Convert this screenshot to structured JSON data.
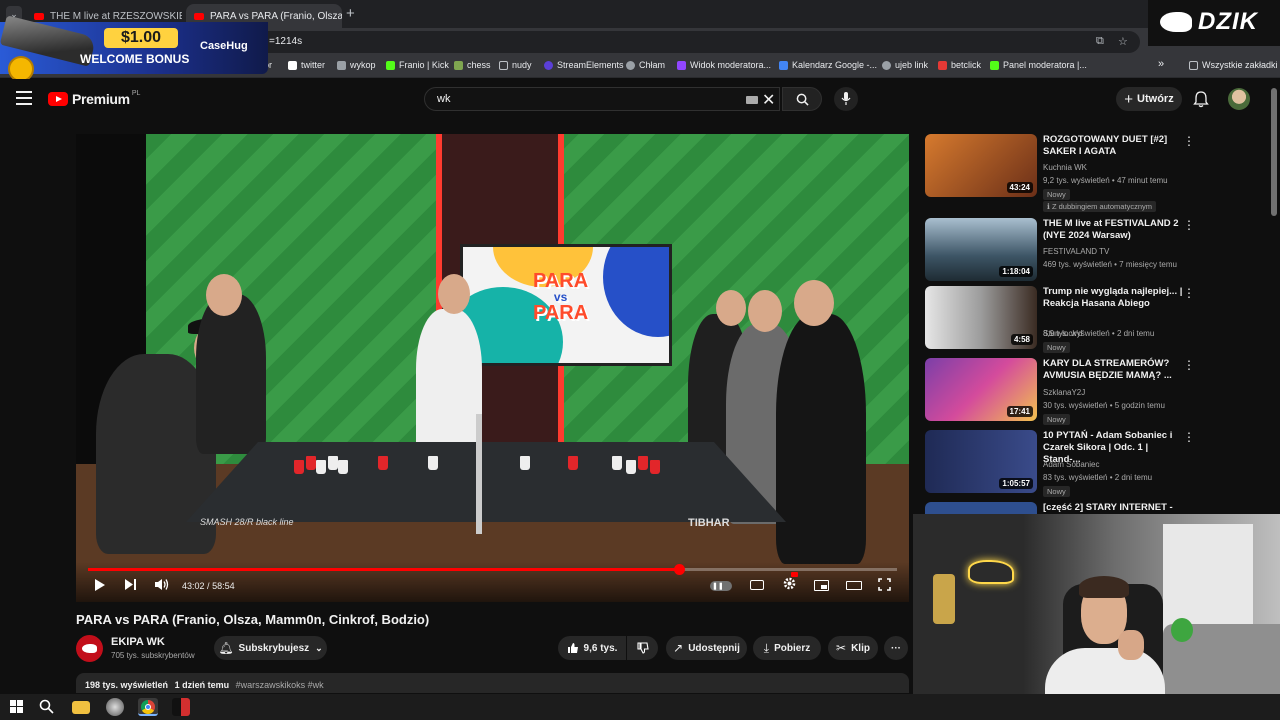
{
  "browser": {
    "tabs": [
      {
        "title": "THE M live at RZESZOWSKIE JUV",
        "active": false
      },
      {
        "title": "PARA vs PARA (Franio, Olsza, M",
        "active": true
      }
    ],
    "new_tab": "+",
    "close": "✕",
    "url_fragment": "=1214s",
    "bookmarks": [
      {
        "label": "twitter",
        "color": "#ffffff"
      },
      {
        "label": "wykop",
        "color": "#9aa0a6"
      },
      {
        "label": "Franio | Kick",
        "color": "#53fc18"
      },
      {
        "label": "chess",
        "color": "#7fa650"
      },
      {
        "label": "nudy",
        "color": "#9aa0a6"
      },
      {
        "label": "StreamElements",
        "color": "#5a3fd7"
      },
      {
        "label": "Chłam",
        "color": "#9aa0a6"
      },
      {
        "label": "Widok moderatora...",
        "color": "#9146ff"
      },
      {
        "label": "Kalendarz Google -...",
        "color": "#4285f4"
      },
      {
        "label": "ujeb link",
        "color": "#9aa0a6"
      },
      {
        "label": "betclick",
        "color": "#e53935"
      },
      {
        "label": "Panel moderatora |...",
        "color": "#53fc18"
      }
    ],
    "bookmarks_more": "»",
    "all_bookmarks": "Wszystkie zakładki",
    "partial_bookmark": "ior"
  },
  "overlay_ad": {
    "amount": "$1.00",
    "bonus": "WELCOME BONUS",
    "brand": "CaseHug"
  },
  "overlay_logo": "DZIK",
  "youtube": {
    "logo": "Premium",
    "country": "PL",
    "search_value": "wk",
    "create_label": "Utwórz",
    "video": {
      "title": "PARA vs PARA (Franio, Olsza, Mamm0n, Cinkrof, Bodzio)",
      "time_current": "43:02",
      "time_total": "58:54",
      "progress": 0.7307,
      "tv_text_1": "PARA",
      "tv_text_2": "vs",
      "tv_text_3": "PARA",
      "table_brand_left": "SMASH 28/R black line",
      "table_brand_right": "TIBHAR"
    },
    "channel": {
      "name": "EKIPA WK",
      "subscribers": "705 tys. subskrybentów",
      "subscribe_label": "Subskrybujesz"
    },
    "actions": {
      "likes": "9,6 tys.",
      "share": "Udostępnij",
      "download": "Pobierz",
      "clip": "Klip"
    },
    "description": {
      "views": "198 tys. wyświetleń",
      "date": "1 dzień temu",
      "tags": "#warszawskikoks #wk"
    },
    "recommendations": [
      {
        "title": "ROZGOTOWANY DUET [#2] SAKER I AGATA",
        "channel": "Kuchnia WK",
        "meta": "9,2 tys. wyświetleń • 47 minut temu",
        "duration": "43:24",
        "badges": [
          "Nowy",
          "Z dubbingiem automatycznym"
        ],
        "thumb": "#d67a2e"
      },
      {
        "title": "THE M live at FESTIVALAND 2 (NYE 2024 Warsaw)",
        "channel": "FESTIVALAND TV",
        "meta": "469 tys. wyświetleń • 7 miesięcy temu",
        "duration": "1:18:04",
        "badges": [],
        "thumb": "#5f7f95"
      },
      {
        "title": "Trump nie wygląda najlepiej... | Reakcja Hasana Abiego",
        "channel": "Stun-lock'd",
        "meta": "8,9 tys. wyświetleń • 2 dni temu",
        "duration": "4:58",
        "badges": [
          "Nowy"
        ],
        "thumb": "#c9c9c9"
      },
      {
        "title": "KARY DLA STREAMERÓW? AVMUSIA BĘDZIE MAMĄ? ...",
        "channel": "SzklanaY2J",
        "meta": "30 tys. wyświetleń • 5 godzin temu",
        "duration": "17:41",
        "badges": [
          "Nowy"
        ],
        "thumb": "#7b3fa8"
      },
      {
        "title": "10 PYTAŃ - Adam Sobaniec i Czarek Sikora | Odc. 1 | Stand-...",
        "channel": "Adam Sobaniec",
        "meta": "83 tys. wyświetleń • 2 dni temu",
        "duration": "1:05:57",
        "badges": [
          "Nowy"
        ],
        "thumb": "#1f2a55"
      },
      {
        "title": "[część 2] STARY INTERNET -",
        "channel": "",
        "meta": "",
        "duration": "",
        "badges": [],
        "thumb": "#2e4f8f"
      }
    ]
  }
}
